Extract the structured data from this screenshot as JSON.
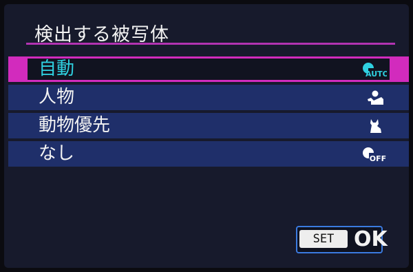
{
  "header": {
    "title": "検出する被写体"
  },
  "menu": {
    "items": [
      {
        "label": "自動",
        "icon": "subject-auto-icon",
        "icon_text": "AUTO",
        "selected": true
      },
      {
        "label": "人物",
        "icon": "person-icon",
        "selected": false
      },
      {
        "label": "動物優先",
        "icon": "animal-icon",
        "selected": false
      },
      {
        "label": "なし",
        "icon": "subject-off-icon",
        "icon_text": "OFF",
        "selected": false
      }
    ]
  },
  "footer": {
    "set_key": "SET",
    "ok_label": "OK"
  },
  "colors": {
    "background": "#171a2c",
    "item": "#1f2f6a",
    "selection": "#d22bbd",
    "selected_text": "#2fd0e0",
    "ok_border": "#3b7be0"
  }
}
